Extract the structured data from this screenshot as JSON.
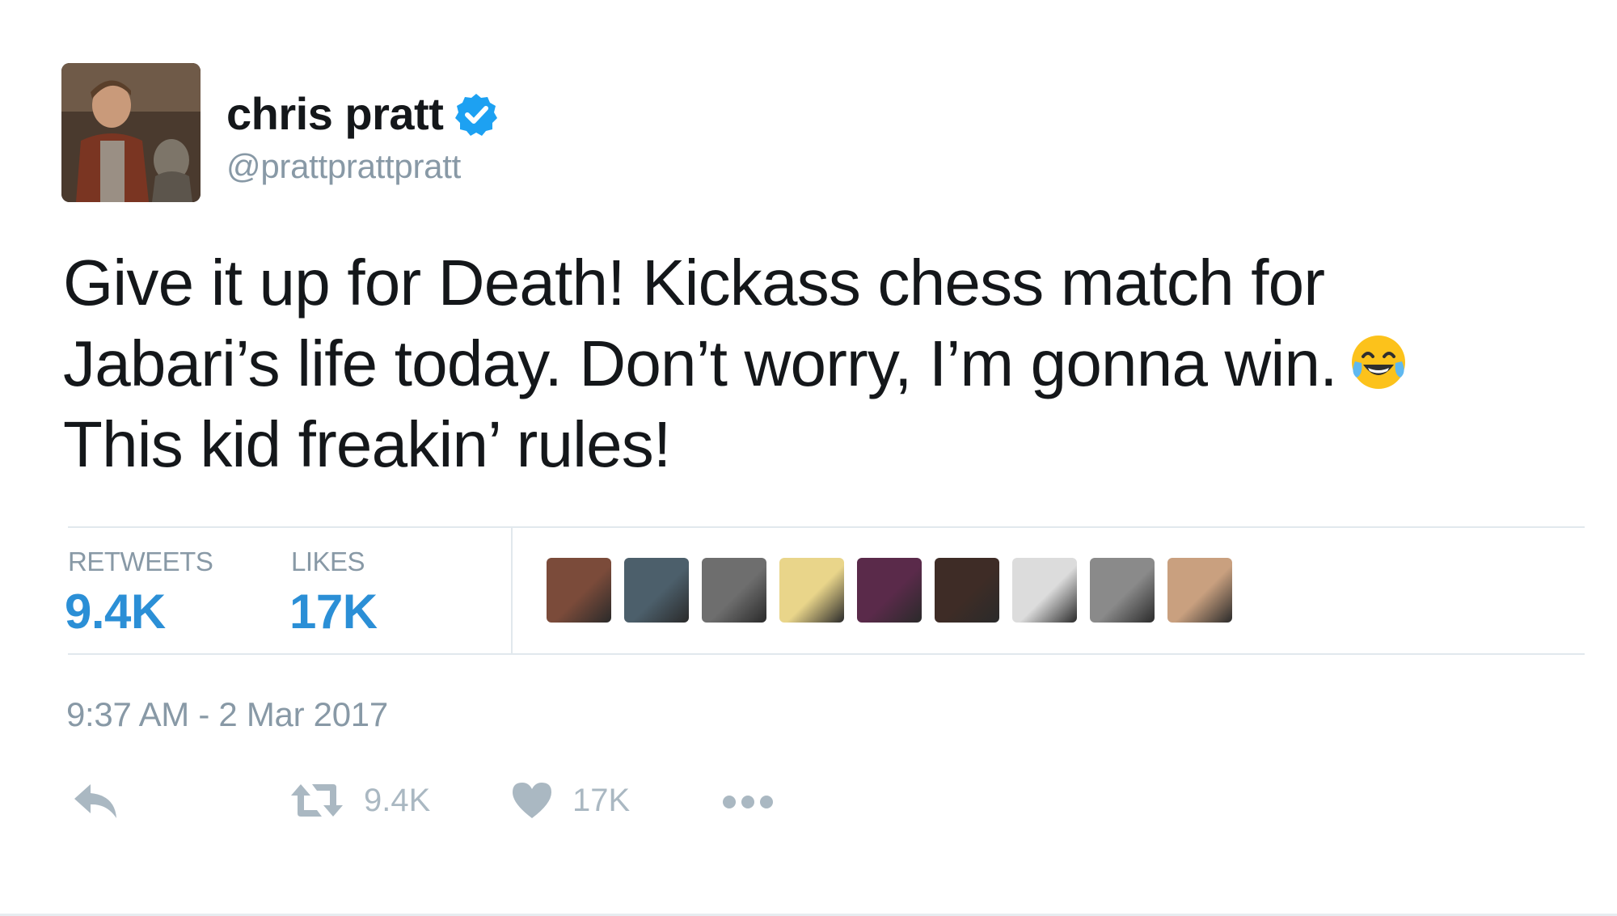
{
  "author": {
    "display_name": "chris pratt",
    "handle": "@prattprattpratt",
    "verified": true,
    "avatar_icon": "profile-photo"
  },
  "tweet": {
    "text": "Give it up for Death! Kickass chess match for\nJabari’s life today. Don’t worry, I’m gonna win.",
    "text_line3": "This kid freakin’ rules!",
    "emoji": "face-with-tears-of-joy"
  },
  "stats": {
    "retweets_label": "RETWEETS",
    "retweets_value": "9.4K",
    "likes_label": "LIKES",
    "likes_value": "17K"
  },
  "likers": [
    {
      "name": "liker-avatar-1",
      "color": "#7b4b3a"
    },
    {
      "name": "liker-avatar-2",
      "color": "#4c5f6b"
    },
    {
      "name": "liker-avatar-3",
      "color": "#6e6e6e"
    },
    {
      "name": "liker-avatar-4",
      "color": "#e9d58a"
    },
    {
      "name": "liker-avatar-5",
      "color": "#5a2a4a"
    },
    {
      "name": "liker-avatar-6",
      "color": "#3e2c26"
    },
    {
      "name": "liker-avatar-7",
      "color": "#dcdcdc"
    },
    {
      "name": "liker-avatar-8",
      "color": "#8a8a8a"
    },
    {
      "name": "liker-avatar-9",
      "color": "#c9a07f"
    }
  ],
  "timestamp": "9:37 AM - 2 Mar 2017",
  "actions": {
    "reply_icon": "reply-icon",
    "retweet_count": "9.4K",
    "like_count": "17K",
    "more_icon": "more-icon"
  },
  "colors": {
    "accent": "#2b8fd6",
    "muted": "#8899a6",
    "icon": "#aab8c2",
    "verified": "#1da1f2"
  }
}
